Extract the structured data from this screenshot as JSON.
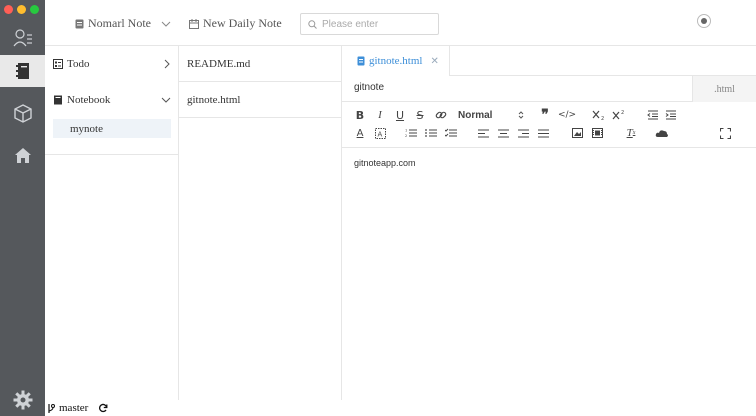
{
  "window": {
    "traffic_colors": [
      "#ff5f56",
      "#ffbd2e",
      "#27c93f"
    ]
  },
  "header": {
    "note_type_label": "Nomarl Note",
    "new_daily_label": "New Daily Note",
    "search_placeholder": "Please enter"
  },
  "categories": {
    "todo_label": "Todo",
    "notebook_label": "Notebook",
    "notebook_items": [
      "mynote"
    ]
  },
  "files": [
    "README.md",
    "gitnote.html"
  ],
  "editor": {
    "tab_label": "gitnote.html",
    "title_value": "gitnote",
    "extension": ".html",
    "format_value": "Normal",
    "content_text": "gitnoteapp.com"
  },
  "status": {
    "branch": "master"
  },
  "colors": {
    "rail": "#55585c",
    "accent": "#3e8fd8"
  }
}
